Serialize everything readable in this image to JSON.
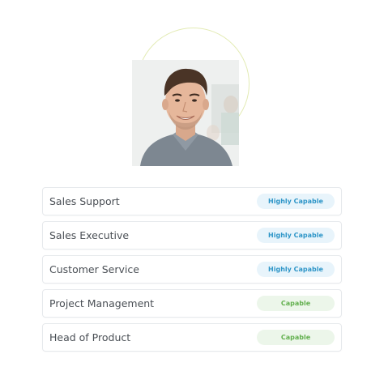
{
  "profile": {
    "photo_icon": "person-portrait",
    "ring_color": "#e3ebb4"
  },
  "skills": [
    {
      "label": "Sales Support",
      "level": "Highly Capable",
      "level_key": "highly"
    },
    {
      "label": "Sales Executive",
      "level": "Highly Capable",
      "level_key": "highly"
    },
    {
      "label": "Customer Service",
      "level": "Highly Capable",
      "level_key": "highly"
    },
    {
      "label": "Project Management",
      "level": "Capable",
      "level_key": "capable"
    },
    {
      "label": "Head of Product",
      "level": "Capable",
      "level_key": "capable"
    }
  ],
  "colors": {
    "highly_bg": "#e8f4fb",
    "highly_text": "#2f96c8",
    "capable_bg": "#ecf6ea",
    "capable_text": "#63b04f"
  }
}
